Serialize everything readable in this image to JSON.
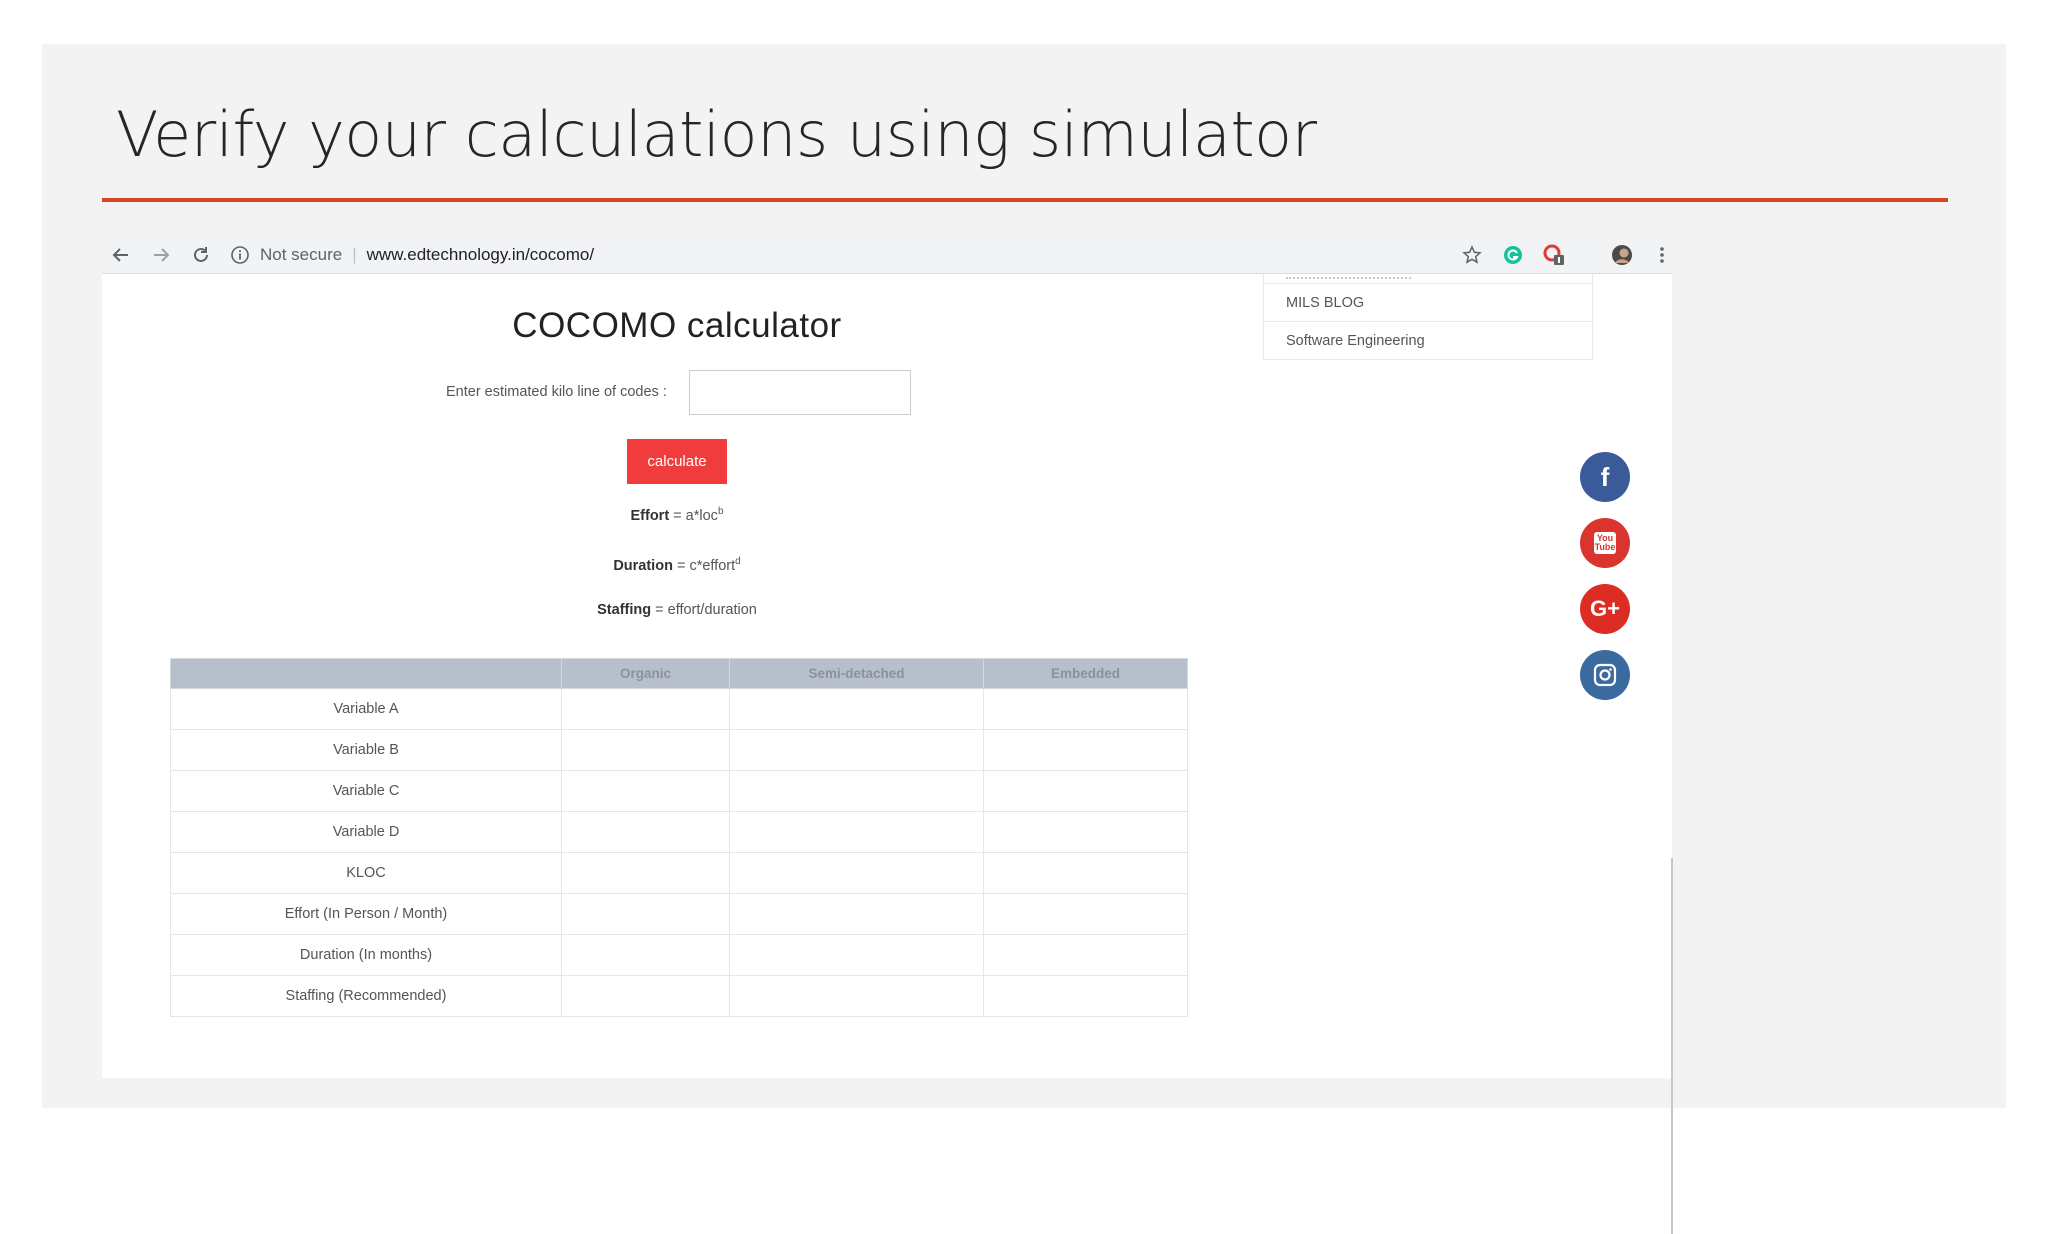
{
  "slide": {
    "title": "Verify your calculations using simulator",
    "accent_color": "#d24726"
  },
  "browser": {
    "security_label": "Not secure",
    "url": "www.edtechnology.in/cocomo/",
    "icons": [
      "back-arrow-icon",
      "forward-arrow-icon",
      "reload-icon",
      "info-icon",
      "star-icon",
      "grammarly-icon",
      "extension-icon",
      "profile-avatar-icon",
      "menu-dots-icon"
    ]
  },
  "sidebar": {
    "items": [
      {
        "label": "MILS BLOG"
      },
      {
        "label": "Software Engineering"
      }
    ]
  },
  "calculator": {
    "title": "COCOMO calculator",
    "kloc_label": "Enter estimated kilo line of codes :",
    "kloc_value": "",
    "button_label": "calculate",
    "button_color": "#f03c3c",
    "formulas": {
      "effort_name": "Effort",
      "effort_expr": " = a*loc",
      "effort_sup": "b",
      "duration_name": "Duration",
      "duration_expr": " = c*effort",
      "duration_sup": "d",
      "staffing_name": "Staffing",
      "staffing_expr": " = effort/duration"
    }
  },
  "table": {
    "headers": [
      "",
      "Organic",
      "Semi-detached",
      "Embedded"
    ],
    "rows": [
      [
        "Variable A",
        "",
        "",
        ""
      ],
      [
        "Variable B",
        "",
        "",
        ""
      ],
      [
        "Variable C",
        "",
        "",
        ""
      ],
      [
        "Variable D",
        "",
        "",
        ""
      ],
      [
        "KLOC",
        "",
        "",
        ""
      ],
      [
        "Effort (In Person / Month)",
        "",
        "",
        ""
      ],
      [
        "Duration (In months)",
        "",
        "",
        ""
      ],
      [
        "Staffing (Recommended)",
        "",
        "",
        ""
      ]
    ]
  },
  "social": [
    {
      "name": "facebook-icon",
      "glyph": "f",
      "color": "#3b5a9a"
    },
    {
      "name": "youtube-icon",
      "glyph": "You Tube",
      "color": "#d9352e"
    },
    {
      "name": "google-plus-icon",
      "glyph": "G+",
      "color": "#dc2d25"
    },
    {
      "name": "instagram-icon",
      "glyph": "",
      "color": "#3b6b9e"
    }
  ]
}
